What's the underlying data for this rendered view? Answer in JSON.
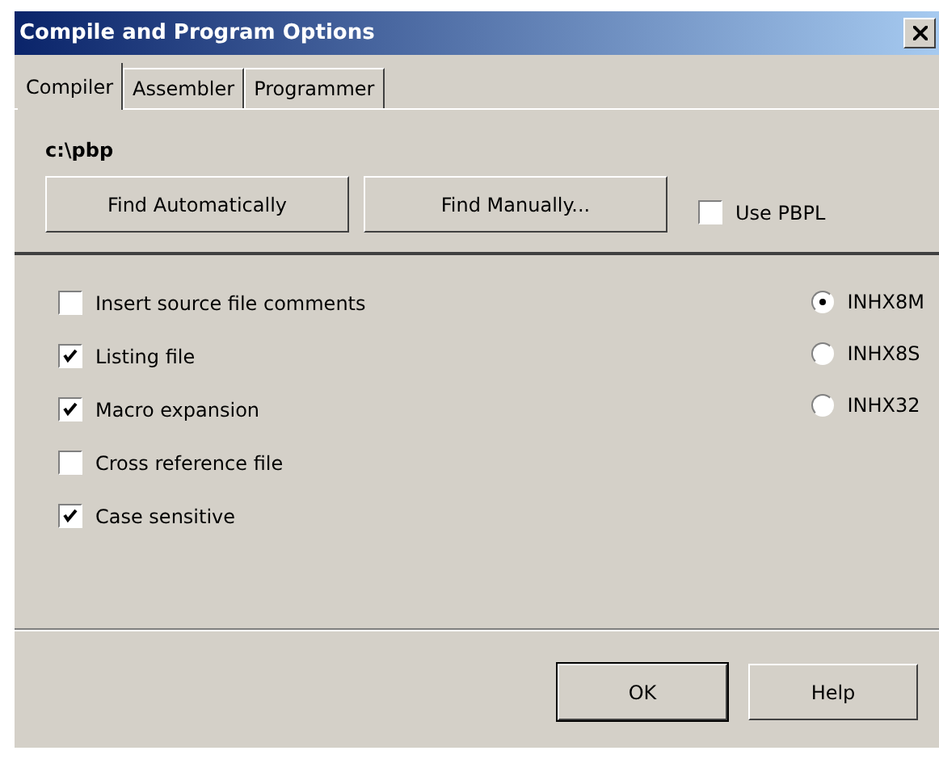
{
  "window": {
    "title": "Compile and Program Options"
  },
  "tabs": [
    {
      "label": "Compiler",
      "selected": true
    },
    {
      "label": "Assembler",
      "selected": false
    },
    {
      "label": "Programmer",
      "selected": false
    }
  ],
  "compiler_path": "c:\\pbp",
  "path_buttons": [
    "Find Automatically",
    "Find Manually..."
  ],
  "use_pbpl": {
    "label": "Use PBPL",
    "checked": false
  },
  "options": [
    {
      "label": "Insert source file comments",
      "checked": false
    },
    {
      "label": "Listing file",
      "checked": true
    },
    {
      "label": "Macro expansion",
      "checked": true
    },
    {
      "label": "Cross reference file",
      "checked": false
    },
    {
      "label": "Case sensitive",
      "checked": true
    }
  ],
  "hex_formats": [
    {
      "label": "INHX8M",
      "selected": true
    },
    {
      "label": "INHX8S",
      "selected": false
    },
    {
      "label": "INHX32",
      "selected": false
    }
  ],
  "buttons": [
    {
      "label": "OK",
      "default": true
    },
    {
      "label": "Help",
      "default": false
    }
  ]
}
